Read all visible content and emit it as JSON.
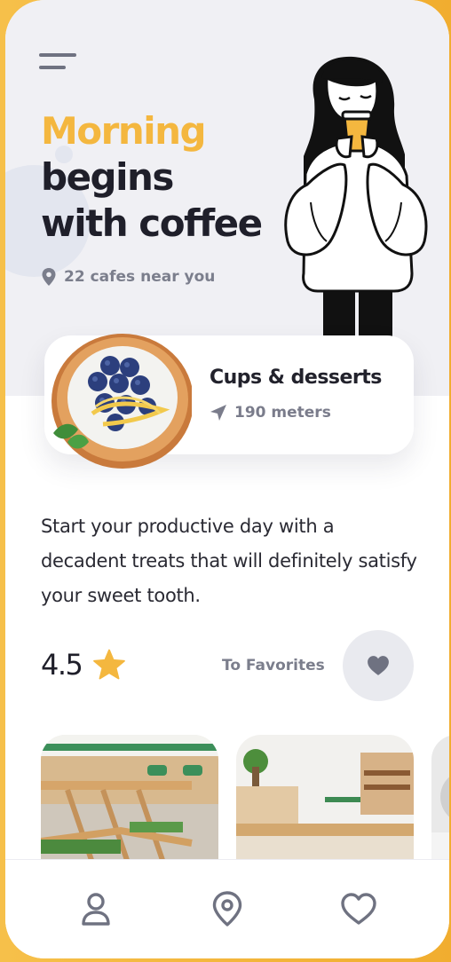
{
  "hero": {
    "title_line1": "Morning",
    "title_line2": "begins",
    "title_line3": "with coffee",
    "nearby": "22 cafes near you"
  },
  "icons": {
    "menu": "hamburger-menu-icon",
    "location": "location-pin-icon",
    "navigation": "navigation-arrow-icon",
    "star": "star-icon",
    "heart": "heart-icon",
    "profile": "user-icon",
    "map": "map-pin-icon",
    "favorites": "heart-outline-icon"
  },
  "featured": {
    "name": "Cups & desserts",
    "distance": "190 meters"
  },
  "description": "Start your productive day with a decadent treats that will definitely satisfy your sweet tooth.",
  "rating": {
    "value": "4.5"
  },
  "favorites": {
    "label": "To Favorites"
  },
  "colors": {
    "accent": "#f4b73f",
    "dark": "#1f1f2a",
    "muted": "#7b7e8c",
    "frame": "#f4b73a"
  }
}
